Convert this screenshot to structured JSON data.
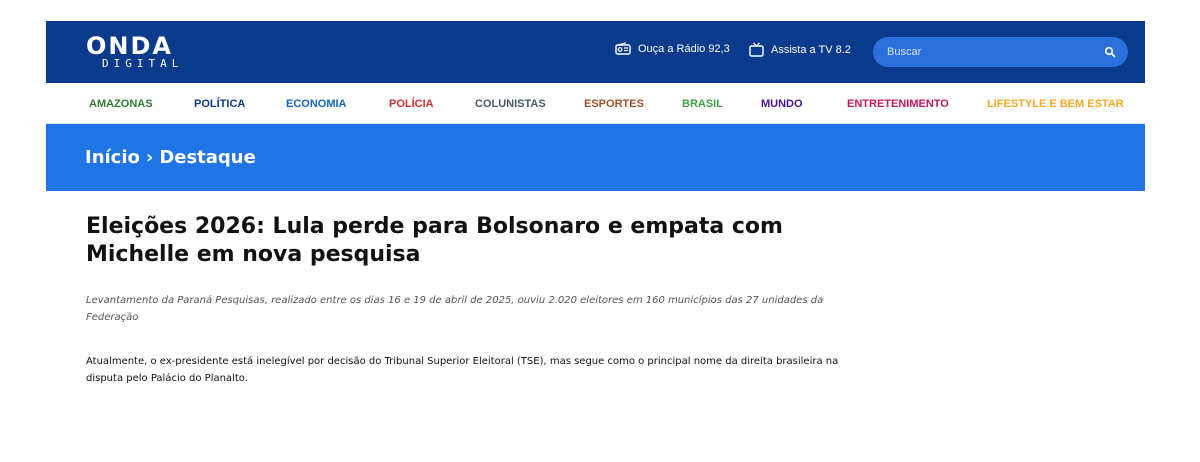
{
  "header": {
    "logo_main": "ONDA",
    "logo_sub": "DIGITAL",
    "radio_label": "Ouça a Rádio 92,3",
    "tv_label": "Assista a TV 8.2",
    "search_placeholder": "Buscar",
    "icons": {
      "radio": "radio-icon",
      "tv": "tv-icon",
      "search": "search-icon"
    }
  },
  "nav": {
    "items": [
      {
        "label": "AMAZONAS",
        "color": "#2e7d32"
      },
      {
        "label": "POLÍTICA",
        "color": "#0a3a8c"
      },
      {
        "label": "ECONOMIA",
        "color": "#1565c0"
      },
      {
        "label": "POLÍCIA",
        "color": "#d32f2f"
      },
      {
        "label": "COLUNISTAS",
        "color": "#455a64"
      },
      {
        "label": "ESPORTES",
        "color": "#a0522d"
      },
      {
        "label": "BRASIL",
        "color": "#43a047"
      },
      {
        "label": "MUNDO",
        "color": "#4a148c"
      },
      {
        "label": "ENTRETENIMENTO",
        "color": "#c2185b"
      },
      {
        "label": "LIFESTYLE E BEM ESTAR",
        "color": "#f9a825"
      }
    ]
  },
  "breadcrumb": {
    "home": "Início",
    "separator": "›",
    "current": "Destaque"
  },
  "article": {
    "title": "Eleições 2026: Lula perde para Bolsonaro e empata com Michelle em nova pesquisa",
    "subtitle": "Levantamento da Paraná Pesquisas, realizado entre os dias 16 e 19 de abril de 2025, ouviu 2.020 eleitores em 160 municípios das 27 unidades da Federação",
    "body": "Atualmente, o ex-presidente está inelegível por decisão do Tribunal Superior Eleitoral (TSE), mas segue como o principal nome da direita brasileira na disputa pelo Palácio do Planalto."
  },
  "colors": {
    "topbar": "#0a3a8c",
    "breadcrumb_bar": "#1f74e6",
    "search_bg": "#2a6fdc"
  }
}
